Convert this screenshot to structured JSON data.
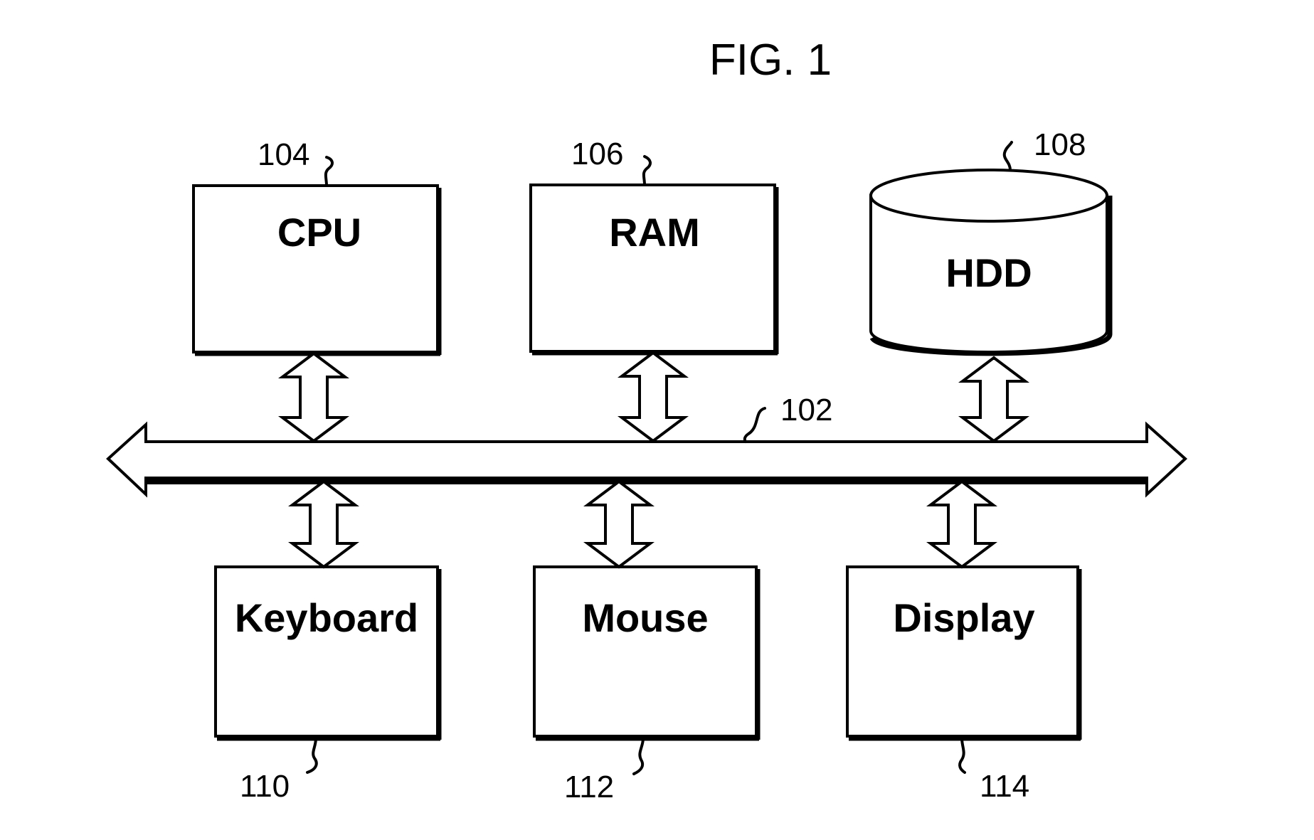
{
  "figure": {
    "title": "FIG. 1"
  },
  "bus": {
    "ref": "102",
    "label": "bus"
  },
  "components": [
    {
      "id": "cpu",
      "label": "CPU",
      "ref": "104",
      "shape": "box",
      "row": "top"
    },
    {
      "id": "ram",
      "label": "RAM",
      "ref": "106",
      "shape": "box",
      "row": "top"
    },
    {
      "id": "hdd",
      "label": "HDD",
      "ref": "108",
      "shape": "cylinder",
      "row": "top"
    },
    {
      "id": "keyboard",
      "label": "Keyboard",
      "ref": "110",
      "shape": "box",
      "row": "bottom"
    },
    {
      "id": "mouse",
      "label": "Mouse",
      "ref": "112",
      "shape": "box",
      "row": "bottom"
    },
    {
      "id": "display",
      "label": "Display",
      "ref": "114",
      "shape": "box",
      "row": "bottom"
    }
  ],
  "connections": [
    {
      "from": "cpu",
      "to": "bus",
      "direction": "bidirectional"
    },
    {
      "from": "ram",
      "to": "bus",
      "direction": "bidirectional"
    },
    {
      "from": "hdd",
      "to": "bus",
      "direction": "bidirectional"
    },
    {
      "from": "keyboard",
      "to": "bus",
      "direction": "bidirectional"
    },
    {
      "from": "mouse",
      "to": "bus",
      "direction": "bidirectional"
    },
    {
      "from": "display",
      "to": "bus",
      "direction": "bidirectional"
    }
  ]
}
